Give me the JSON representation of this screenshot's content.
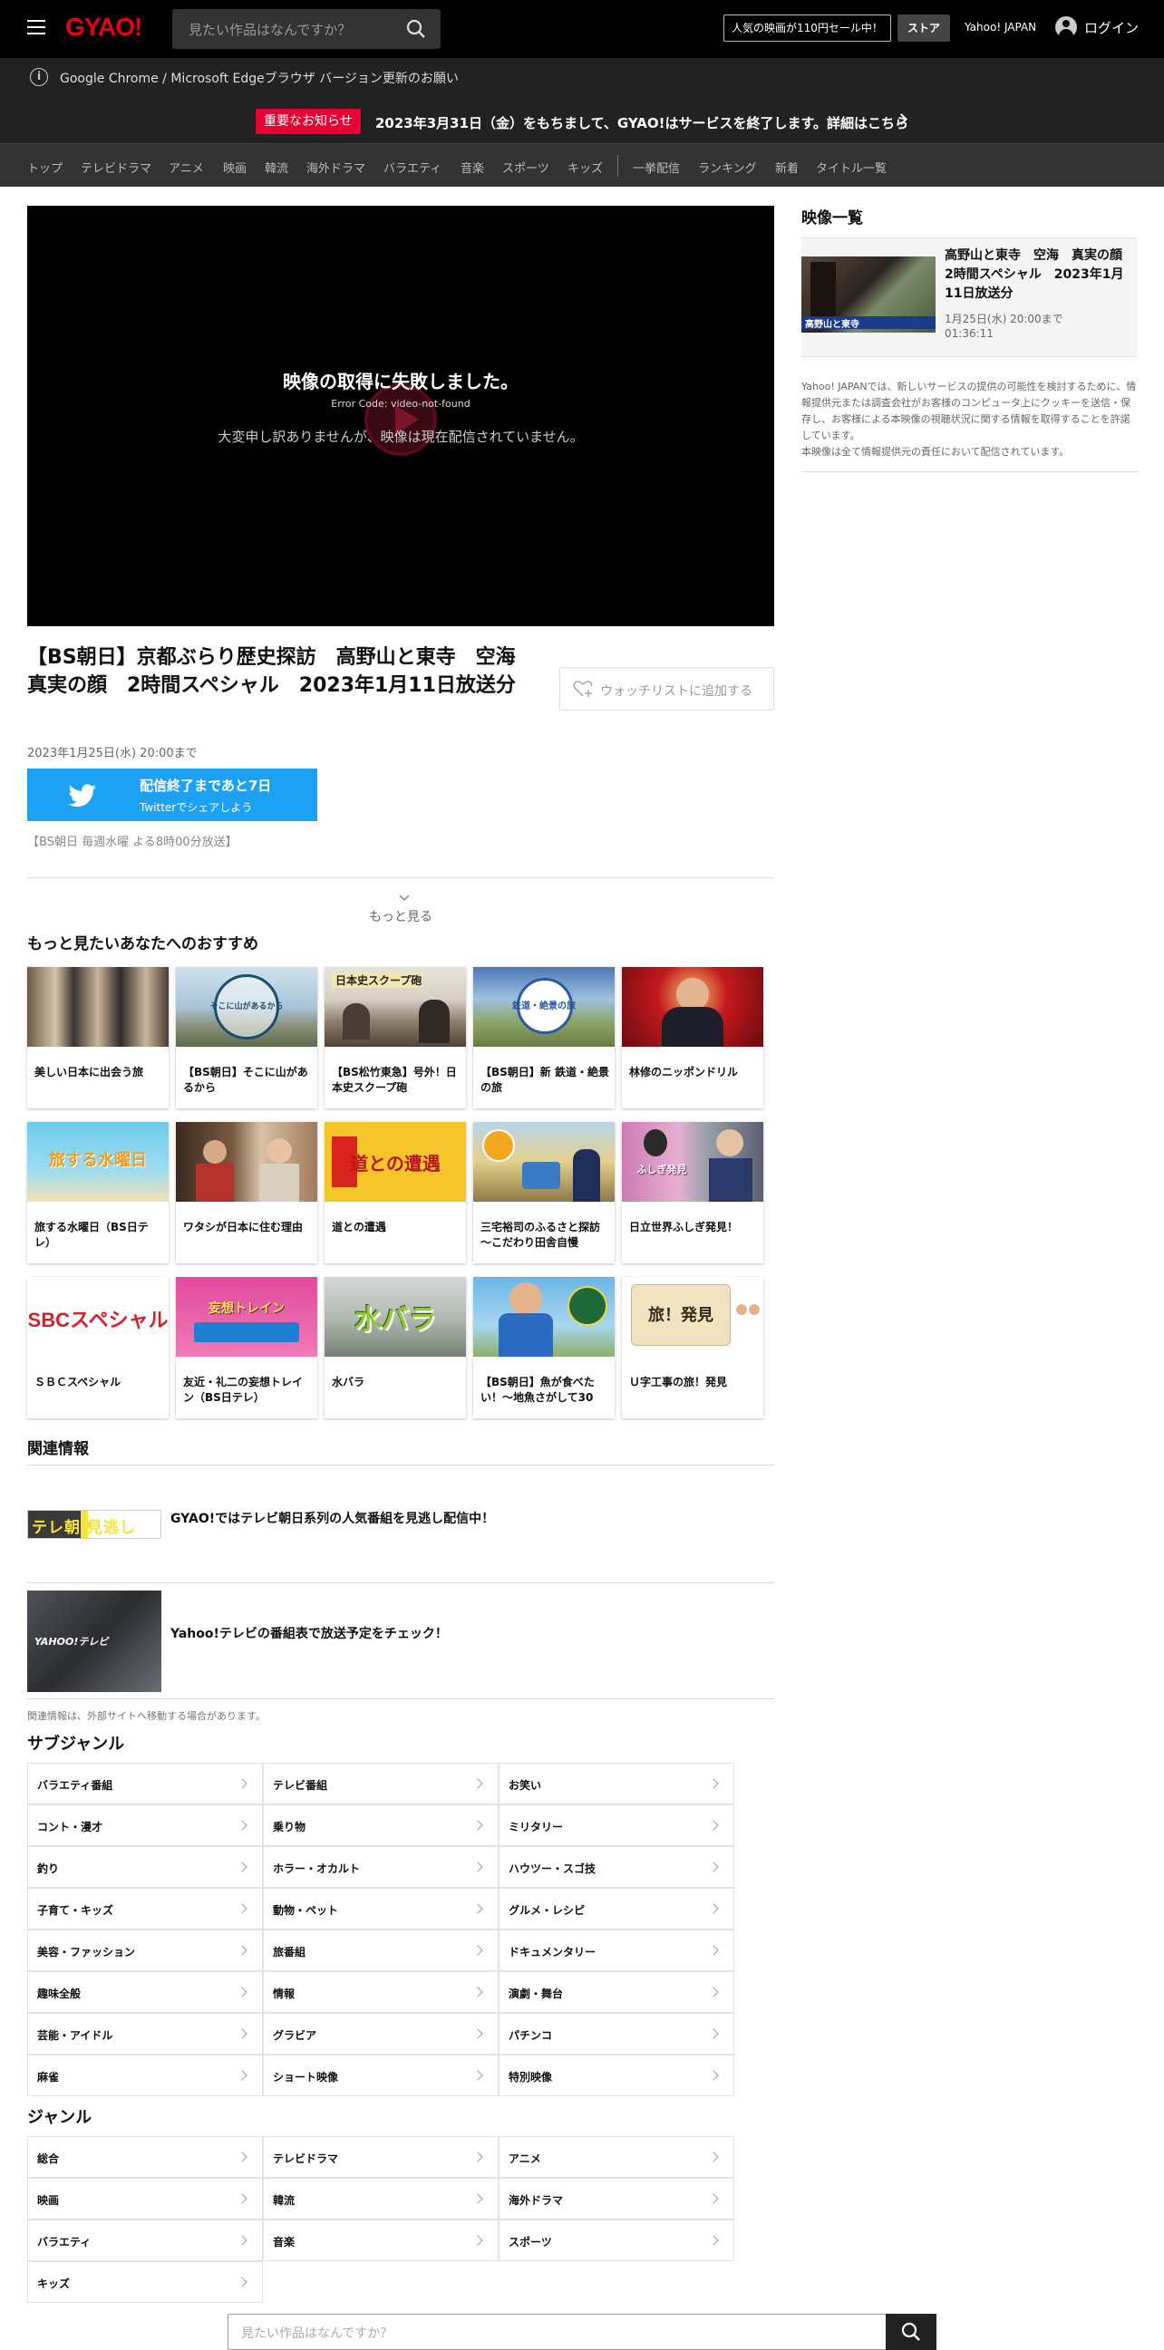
{
  "header": {
    "logo": "GYAO!",
    "search_placeholder": "見たい作品はなんですか？",
    "sale": "人気の映画が110円セール中！",
    "store": "ストア",
    "yahoo": "Yahoo! JAPAN",
    "login": "ログイン"
  },
  "browser_notice": "Google Chrome / Microsoft Edgeブラウザ バージョン更新のお願い",
  "notice": {
    "badge": "重要なお知らせ",
    "message": "2023年3月31日（金）をもちまして、GYAO!はサービスを終了します。詳細はこちら"
  },
  "nav": [
    "トップ",
    "テレビドラマ",
    "アニメ",
    "映画",
    "韓流",
    "海外ドラマ",
    "バラエティ",
    "音楽",
    "スポーツ",
    "キッズ",
    "一挙配信",
    "ランキング",
    "新着",
    "タイトル一覧"
  ],
  "player": {
    "error_title": "映像の取得に失敗しました。",
    "error_code": "Error Code: video-not-found",
    "error_message": "大変申し訳ありませんが、映像は現在配信されていません。"
  },
  "video": {
    "title": "【BS朝日】京都ぶらり歴史探訪　高野山と東寺　空海　真実の顔　2時間スペシャル　2023年1月11日放送分",
    "watchlist": "ウォッチリストに追加する",
    "period": "2023年1月25日(水) 20:00まで",
    "broadcast": "【BS朝日 毎週水曜 よる8時00分放送】"
  },
  "twitter": {
    "line1": "配信終了まであと7日",
    "line2": "Twitterでシェアしよう"
  },
  "more": "もっと見る",
  "recommend": {
    "heading": "もっと見たいあなたへのおすすめ",
    "items": [
      {
        "name": "美しい日本に出会う旅",
        "thumb_text": ""
      },
      {
        "name": "【BS朝日】そこに山があるから",
        "thumb_text": "そこに山があるから"
      },
      {
        "name": "【BS松竹東急】号外！日本史スクープ砲",
        "thumb_text": "日本史スクープ砲"
      },
      {
        "name": "【BS朝日】新 鉄道・絶景の旅",
        "thumb_text": "鉄道・絶景の旅"
      },
      {
        "name": "林修のニッポンドリル",
        "thumb_text": ""
      },
      {
        "name": "旅する水曜日（BS日テレ）",
        "thumb_text": "旅する水曜日"
      },
      {
        "name": "ワタシが日本に住む理由",
        "thumb_text": ""
      },
      {
        "name": "道との遭遇",
        "thumb_text": "道との遭遇"
      },
      {
        "name": "三宅裕司のふるさと探訪～こだわり田舎自慢",
        "thumb_text": ""
      },
      {
        "name": "日立世界ふしぎ発見！",
        "thumb_text": "ふしぎ発見"
      },
      {
        "name": "ＳＢＣスペシャル",
        "thumb_text": "SBCスペシャル"
      },
      {
        "name": "友近・礼二の妄想トレイン（BS日テレ）",
        "thumb_text": "妄想トレイン"
      },
      {
        "name": "水バラ",
        "thumb_text": "水バラ"
      },
      {
        "name": "【BS朝日】魚が食べたい！～地魚さがして30",
        "thumb_text": ""
      },
      {
        "name": "Ｕ字工事の旅！発見",
        "thumb_text": "旅！発見"
      }
    ]
  },
  "related": {
    "heading": "関連情報",
    "items": [
      {
        "text": "GYAO!ではテレビ朝日系列の人気番組を見逃し配信中！",
        "img_text": "テレ朝 見逃し"
      },
      {
        "text": "Yahoo!テレビの番組表で放送予定をチェック！",
        "img_text": "YAHOO!テレビ"
      }
    ],
    "note": "関連情報は、外部サイトへ移動する場合があります。"
  },
  "subgenre": {
    "heading": "サブジャンル",
    "items": [
      "バラエティ番組",
      "テレビ番組",
      "お笑い",
      "コント・漫才",
      "乗り物",
      "ミリタリー",
      "釣り",
      "ホラー・オカルト",
      "ハウツー・スゴ技",
      "子育て・キッズ",
      "動物・ペット",
      "グルメ・レシピ",
      "美容・ファッション",
      "旅番組",
      "ドキュメンタリー",
      "趣味全般",
      "情報",
      "演劇・舞台",
      "芸能・アイドル",
      "グラビア",
      "パチンコ",
      "麻雀",
      "ショート映像",
      "特別映像"
    ]
  },
  "genre": {
    "heading": "ジャンル",
    "items": [
      "総合",
      "テレビドラマ",
      "アニメ",
      "映画",
      "韓流",
      "海外ドラマ",
      "バラエティ",
      "音楽",
      "スポーツ",
      "キッズ"
    ]
  },
  "sidebar": {
    "heading": "映像一覧",
    "item": {
      "title": "高野山と東寺　空海　真実の顔　2時間スペシャル　2023年1月11日放送分",
      "date": "1月25日(水) 20:00まで",
      "duration": "01:36:11",
      "thumb_text": "高野山と東寺"
    },
    "disclaimer": "Yahoo! JAPANでは、新しいサービスの提供の可能性を検討するために、情報提供元または調査会社がお客様のコンピュータ上にクッキーを送信・保存し、お客様による本映像の視聴状況に関する情報を取得することを許諾しています。",
    "disclaimer2": "本映像は全て情報提供元の責任において配信されています。"
  },
  "footer": {
    "search_placeholder": "見たい作品はなんですか？"
  },
  "colors": {
    "brand": "#e60012",
    "twitter": "#1da1f2",
    "notice_badge": "#e60033"
  }
}
